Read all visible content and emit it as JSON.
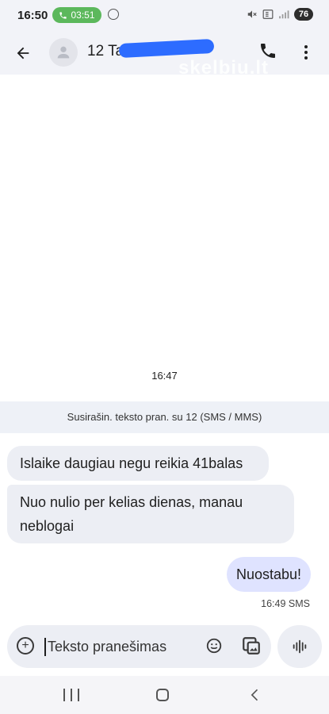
{
  "status_bar": {
    "time": "16:50",
    "call_duration": "03:51",
    "battery": "76",
    "icons": [
      "phone-icon",
      "messenger-icon",
      "mute-icon",
      "5g-icon",
      "signal-icon",
      "battery-icon"
    ]
  },
  "app_bar": {
    "contact_name": "12 Tad",
    "watermark": "skelbiu.lt",
    "icons": [
      "back-arrow-icon",
      "person-icon",
      "phone-icon",
      "more-vert-icon"
    ]
  },
  "conversation": {
    "timestamp": "16:47",
    "sim_banner": "Susirašin. teksto pran. su 12 (SMS / MMS)",
    "incoming": [
      {
        "text": "Islaike daugiau negu reikia 41balas"
      },
      {
        "text": "Nuo nulio per kelias dienas, manau neblogai"
      }
    ],
    "outgoing": [
      {
        "text": "Nuostabu!",
        "meta": "16:49 SMS"
      }
    ]
  },
  "compose": {
    "placeholder": "Teksto pranešimas",
    "value": "",
    "icons": [
      "add-icon",
      "emoji-icon",
      "gallery-icon",
      "voice-icon"
    ]
  },
  "nav_bar": {
    "icons": [
      "recents-icon",
      "home-icon",
      "back-icon"
    ]
  },
  "colors": {
    "header_bg": "#f2f3f8",
    "incoming_bubble": "#eceef4",
    "outgoing_bubble": "#dfe3ff",
    "call_pill": "#5cb85c",
    "redaction": "#2d6cff"
  }
}
